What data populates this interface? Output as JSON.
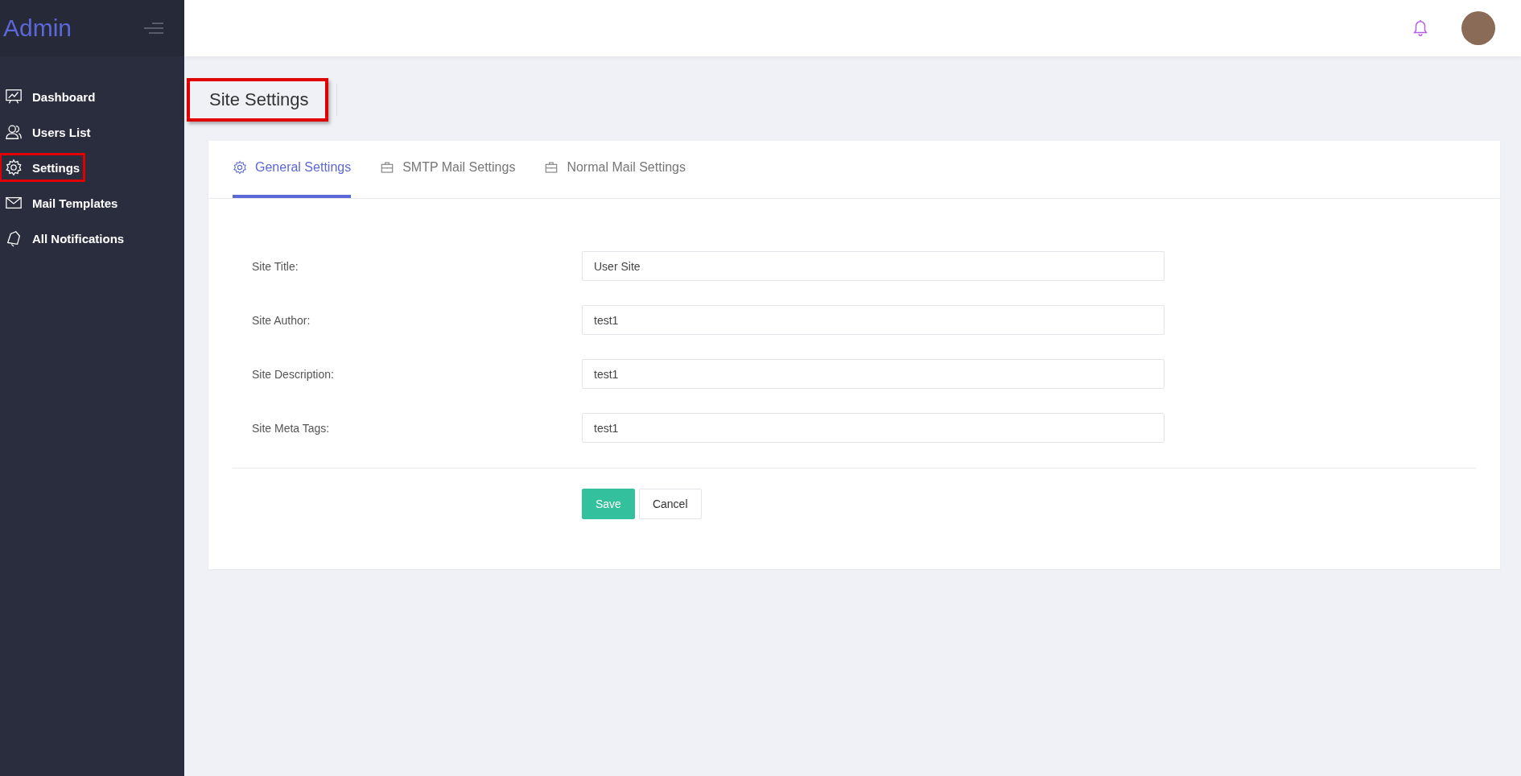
{
  "sidebar": {
    "logo": "Admin",
    "items": [
      {
        "label": "Dashboard",
        "kind": "chart",
        "highlighted": false
      },
      {
        "label": "Users List",
        "kind": "users",
        "highlighted": false
      },
      {
        "label": "Settings",
        "kind": "gear",
        "highlighted": true
      },
      {
        "label": "Mail Templates",
        "kind": "mail",
        "highlighted": false
      },
      {
        "label": "All Notifications",
        "kind": "bell",
        "highlighted": false
      }
    ]
  },
  "page_title": {
    "text": "Site Settings",
    "highlighted": true
  },
  "tabs": [
    {
      "label": "General Settings",
      "kind": "gear",
      "selected": true
    },
    {
      "label": "SMTP Mail Settings",
      "kind": "case",
      "selected": false
    },
    {
      "label": "Normal Mail Settings",
      "kind": "case",
      "selected": false
    }
  ],
  "form": {
    "fields": [
      {
        "label": "Site Title:",
        "value": "User Site"
      },
      {
        "label": "Site Author:",
        "value": "test1"
      },
      {
        "label": "Site Description:",
        "value": "test1"
      },
      {
        "label": "Site Meta Tags:",
        "value": "test1"
      }
    ],
    "buttons": [
      {
        "label": "Save",
        "kind": "primary"
      },
      {
        "label": "Cancel",
        "kind": "secondary"
      }
    ]
  }
}
